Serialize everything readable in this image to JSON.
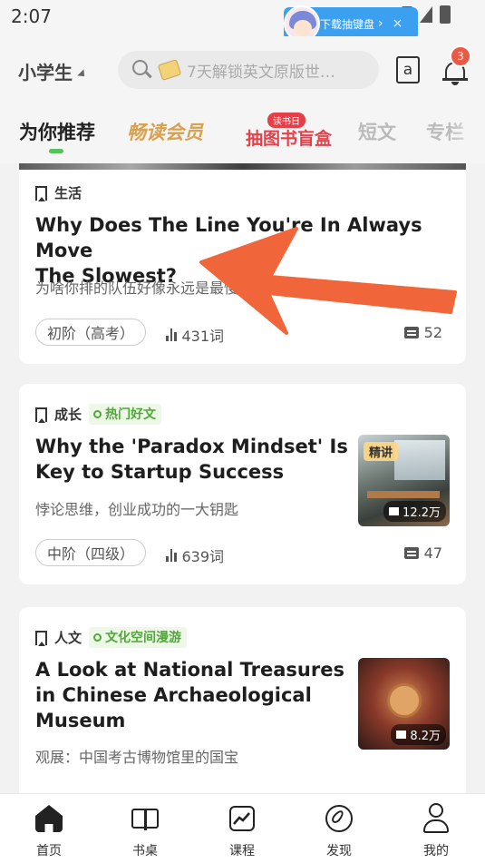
{
  "status_bar": {
    "time": "2:07",
    "promo": {
      "text": "下载抽键盘",
      "arrow": "›",
      "close": "×"
    }
  },
  "header": {
    "grade": "小学生",
    "search_placeholder": "7天解锁英文原版世…",
    "dict_icon_label": "a",
    "notification_count": "3"
  },
  "tabs": {
    "items": [
      {
        "label": "为你推荐",
        "active": true
      },
      {
        "label": "畅读会员"
      },
      {
        "label": "抽图书盲盒",
        "tag": "读书日"
      },
      {
        "label": "短文"
      },
      {
        "label": "专栏"
      }
    ]
  },
  "feed": [
    {
      "category": "生活",
      "title_lines": [
        "Why Does The Line You're In Always Move",
        "The Slowest?"
      ],
      "subtitle": "为啥你排的队伍好像永远是最慢的?",
      "level": "初阶（高考）",
      "words": "431词",
      "comments": "52"
    },
    {
      "category": "成长",
      "tag": "热门好文",
      "title_lines": [
        "Why the 'Paradox Mindset' Is",
        "Key to Startup Success"
      ],
      "subtitle": "悖论思维，创业成功的一大钥匙",
      "thumb_tag": "精讲",
      "thumb_reads": "12.2万",
      "level": "中阶（四级）",
      "words": "639词",
      "comments": "47"
    },
    {
      "category": "人文",
      "tag": "文化空间漫游",
      "title_lines": [
        "A Look at National Treasures",
        "in Chinese Archaeological",
        "Museum"
      ],
      "subtitle": "观展：中国考古博物馆里的国宝",
      "thumb_reads": "8.2万"
    }
  ],
  "bottom_nav": [
    {
      "label": "首页",
      "icon": "home-icon"
    },
    {
      "label": "书桌",
      "icon": "book-icon"
    },
    {
      "label": "课程",
      "icon": "chart-icon"
    },
    {
      "label": "发现",
      "icon": "compass-icon"
    },
    {
      "label": "我的",
      "icon": "user-icon"
    }
  ],
  "colors": {
    "accent_green": "#56c25c",
    "vip_gold": "#d9a04e",
    "promo_red": "#e5404a",
    "annotation_arrow": "#f0663a"
  }
}
